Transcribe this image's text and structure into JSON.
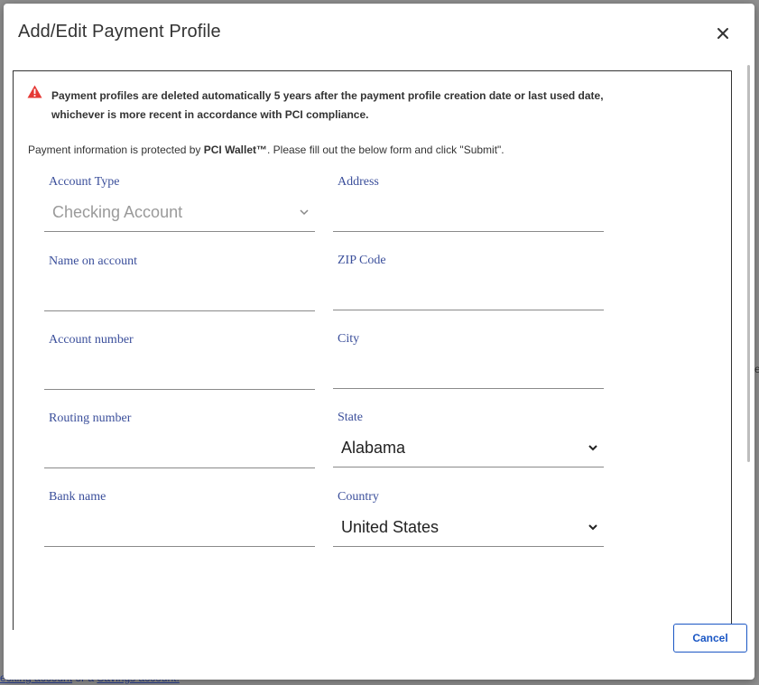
{
  "background": {
    "link_part1": "ecking account",
    "link_part2": " or a ",
    "link_part3": "Savings account.",
    "edge_mark": "e"
  },
  "dialog": {
    "title": "Add/Edit Payment Profile",
    "close_icon": "close-icon",
    "warning": {
      "icon": "warning-triangle-icon",
      "color": "#e53935",
      "text": "Payment profiles are deleted automatically 5 years after the payment profile creation date or last used date, whichever is more recent in accordance with PCI compliance."
    },
    "info": {
      "prefix": "Payment information is protected by ",
      "brand": "PCI Wallet™",
      "suffix": ". Please fill out the below form and click \"Submit\"."
    },
    "form": {
      "account_type": {
        "label": "Account Type",
        "value": "Checking Account"
      },
      "name_on_account": {
        "label": "Name on account",
        "value": ""
      },
      "account_number": {
        "label": "Account number",
        "value": ""
      },
      "routing_number": {
        "label": "Routing number",
        "value": ""
      },
      "bank_name": {
        "label": "Bank name",
        "value": ""
      },
      "address": {
        "label": "Address",
        "value": ""
      },
      "zip_code": {
        "label": "ZIP Code",
        "value": ""
      },
      "city": {
        "label": "City",
        "value": ""
      },
      "state": {
        "label": "State",
        "value": "Alabama"
      },
      "country": {
        "label": "Country",
        "value": "United States"
      }
    },
    "cancel_label": "Cancel",
    "accent_color": "#1a56c4",
    "label_color": "#3b4f9b"
  }
}
